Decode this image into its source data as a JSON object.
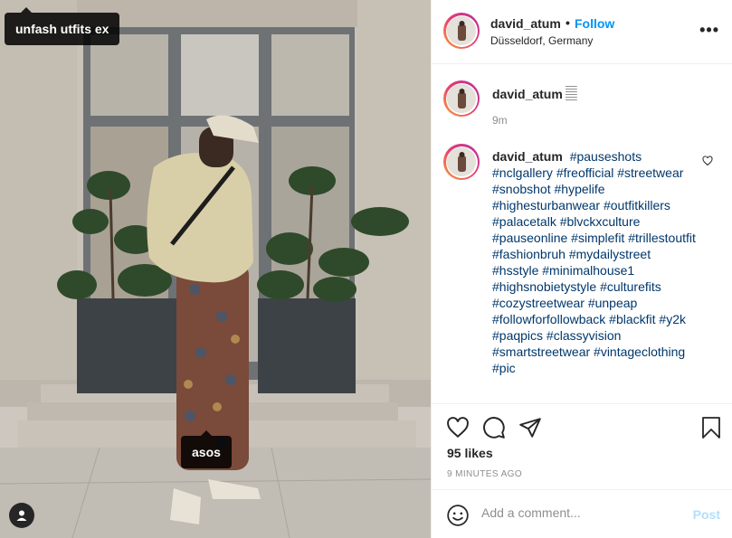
{
  "post": {
    "photo_tags": [
      {
        "label": "unfash utfits ex"
      },
      {
        "label": "asos"
      }
    ],
    "icons": {
      "user_tags": "person-icon"
    }
  },
  "header": {
    "username": "david_atum",
    "separator": "•",
    "follow_label": "Follow",
    "location": "Düsseldorf, Germany",
    "more_label": "•••"
  },
  "comments": [
    {
      "username": "david_atum",
      "text": "𝄛",
      "time": "9m"
    },
    {
      "username": "david_atum",
      "text": "#pauseshots #nclgallery #freofficial #streetwear #snobshot #hypelife #highesturbanwear #outfitkillers #palacetalk #blvckxculture #pauseonline #simplefit #trillestoutfit #fashionbruh #mydailystreet #hsstyle #minimalhouse1 #highsnobietystyle #culturefits #cozystreetwear #unpeap #followforfollowback #blackfit #y2k #paqpics #classyvision #smartstreetwear #vintageclothing #pic"
    }
  ],
  "actions": {
    "likes": "95 likes",
    "time_ago": "9 MINUTES AGO"
  },
  "add_comment": {
    "placeholder": "Add a comment...",
    "post_label": "Post"
  },
  "colors": {
    "link": "#0095f6",
    "hashtag": "#00376b",
    "muted": "#8e8e8e",
    "post_disabled": "#b2dffc"
  }
}
